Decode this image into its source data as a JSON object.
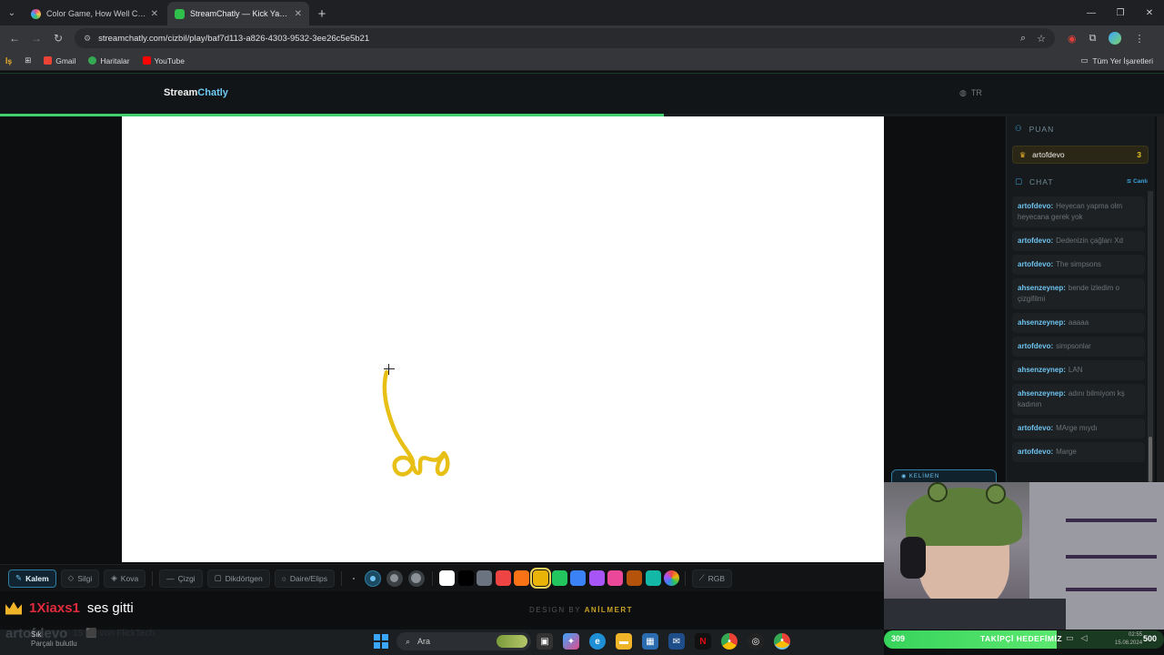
{
  "browser": {
    "tabs": [
      {
        "title": "Color Game, How Well Can You",
        "favicon_color": "#e24c8a",
        "active": false
      },
      {
        "title": "StreamChatly — Kick Yayıncıları",
        "favicon_color": "#2fbf4a",
        "active": true
      }
    ],
    "url": "streamchatly.com/cizbil/play/baf7d113-a826-4303-9532-3ee26c5e5b21",
    "bookmarks": [
      "İş",
      "Gmail",
      "Haritalar",
      "YouTube"
    ],
    "all_bookmarks": "Tüm Yer İşaretleri"
  },
  "site": {
    "logo_main": "Stream",
    "logo_accent": "Chatly",
    "language": "TR",
    "round_progress": 0.57
  },
  "panel": {
    "score_heading": "PUAN",
    "scores": [
      {
        "user": "artofdevo",
        "points": "3"
      }
    ],
    "chat_heading": "CHAT",
    "live_label": "Canlı",
    "messages": [
      {
        "user": "artofdevo:",
        "text": "Heyecan yapma olm heyecana gerek yok"
      },
      {
        "user": "artofdevo:",
        "text": "Dedenizin çağları Xd"
      },
      {
        "user": "artofdevo:",
        "text": "The simpsons"
      },
      {
        "user": "ahsenzeynep:",
        "text": "bende izledim o çizgifilmi"
      },
      {
        "user": "ahsenzeynep:",
        "text": "aaaaa"
      },
      {
        "user": "artofdevo:",
        "text": "simpsonlar"
      },
      {
        "user": "ahsenzeynep:",
        "text": "LAN"
      },
      {
        "user": "ahsenzeynep:",
        "text": "adını bilmiyom kş kadının"
      },
      {
        "user": "artofdevo:",
        "text": "MArge mıydı"
      },
      {
        "user": "artofdevo:",
        "text": "Marge"
      }
    ],
    "word_button": "KELİMEN"
  },
  "toolbar": {
    "tools": [
      {
        "label": "Kalem",
        "icon": "pencil-icon",
        "glyph": "✎",
        "active": true
      },
      {
        "label": "Silgi",
        "icon": "eraser-icon",
        "glyph": "◇",
        "active": false
      },
      {
        "label": "Kova",
        "icon": "bucket-icon",
        "glyph": "◈",
        "active": false
      }
    ],
    "shapes": [
      {
        "label": "Çizgi",
        "icon": "line-icon",
        "glyph": "—"
      },
      {
        "label": "Dikdörtgen",
        "icon": "rectangle-icon",
        "glyph": "▢"
      },
      {
        "label": "Daire/Elips",
        "icon": "circle-icon",
        "glyph": "○"
      }
    ],
    "brush_sizes": [
      {
        "size": "small",
        "active": false
      },
      {
        "size": "medium",
        "active": true
      },
      {
        "size": "large",
        "active": false
      },
      {
        "size": "xlarge",
        "active": false
      }
    ],
    "colors": [
      "#ffffff",
      "#000000",
      "#6b7280",
      "#ef4444",
      "#f97316",
      "#eab308",
      "#22c55e",
      "#3b82f6",
      "#a855f7",
      "#ec4899",
      "#b45309",
      "#14b8a6",
      "rainbow"
    ],
    "selected_color": "#eab308",
    "rgb_label": "RGB"
  },
  "footer": {
    "design_prefix": "DESIGN BY",
    "design_name": "ANİLMERT"
  },
  "stream_overlay": {
    "chat_user": "1Xiaxs1",
    "chat_text": "ses gitti",
    "chat_user2": "artofdevo",
    "chat_text2": "15 ⬛ von FlickTech",
    "follower_count": "309",
    "follower_label": "TAKİPÇİ HEDEFİMİZ",
    "follower_goal": "500",
    "follower_progress": 0.618
  },
  "taskbar": {
    "notification_title": "Sık",
    "notification_sub": "Parçalı bulutlu",
    "search_placeholder": "Ara",
    "time": "02:55",
    "date": "15.08.2024"
  }
}
